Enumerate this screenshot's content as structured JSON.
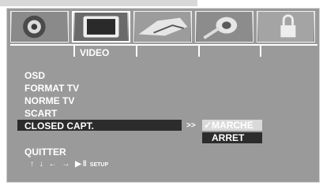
{
  "tabs": [
    {
      "icon": "speaker-icon"
    },
    {
      "icon": "tv-icon"
    },
    {
      "icon": "hand-icon"
    },
    {
      "icon": "microphone-icon"
    },
    {
      "icon": "lock-icon"
    }
  ],
  "active_tab_label": "VIDEO",
  "menu": {
    "items": [
      "OSD",
      "FORMAT TV",
      "NORME TV",
      "SCART",
      "CLOSED CAPT."
    ],
    "selected": "CLOSED CAPT.",
    "indicator": ">>"
  },
  "submenu": {
    "options": [
      {
        "label": "✓MARCHE",
        "state": "highlighted"
      },
      {
        "label": "ARRET",
        "state": "normal"
      }
    ]
  },
  "quit_label": "QUITTER",
  "nav": {
    "keys": "↑ ↓ ← → ▶‖",
    "setup": "SETUP"
  },
  "colors": {
    "panel": "#9a9a9a",
    "highlight_dark": "#2c2c2c",
    "highlight_light": "#d9d9d9",
    "text": "#ffffff"
  }
}
